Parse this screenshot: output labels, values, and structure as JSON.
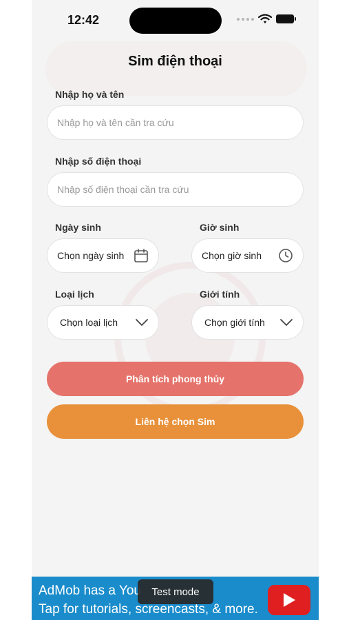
{
  "status_bar": {
    "time": "12:42"
  },
  "page": {
    "title": "Sim điện thoại"
  },
  "form": {
    "name": {
      "label": "Nhập họ và tên",
      "placeholder": "Nhập họ và tên cần tra cứu"
    },
    "phone": {
      "label": "Nhập số điện thoại",
      "placeholder": "Nhập số điện thoại cần tra cứu"
    },
    "birth_date": {
      "label": "Ngày sinh",
      "value": "Chọn ngày sinh",
      "icon": "calendar-icon"
    },
    "birth_time": {
      "label": "Giờ sinh",
      "value": "Chọn giờ sinh",
      "icon": "clock-icon"
    },
    "calendar_type": {
      "label": "Loại lịch",
      "value": "Chọn loại lịch",
      "icon": "chevron-down-icon"
    },
    "gender": {
      "label": "Giới tính",
      "value": "Chọn giới tính",
      "icon": "chevron-down-icon"
    }
  },
  "actions": {
    "analyze_label": "Phân tích phong thủy",
    "contact_label": "Liên hệ chọn Sim"
  },
  "ad": {
    "line1": "AdMob has a You",
    "line2": "Tap for tutorials, screencasts, & more.",
    "toast": "Test mode",
    "icon": "youtube-play-icon"
  },
  "colors": {
    "analyze_button": "#e5736b",
    "contact_button": "#e8913a",
    "ad_background": "#1a8ccb"
  }
}
